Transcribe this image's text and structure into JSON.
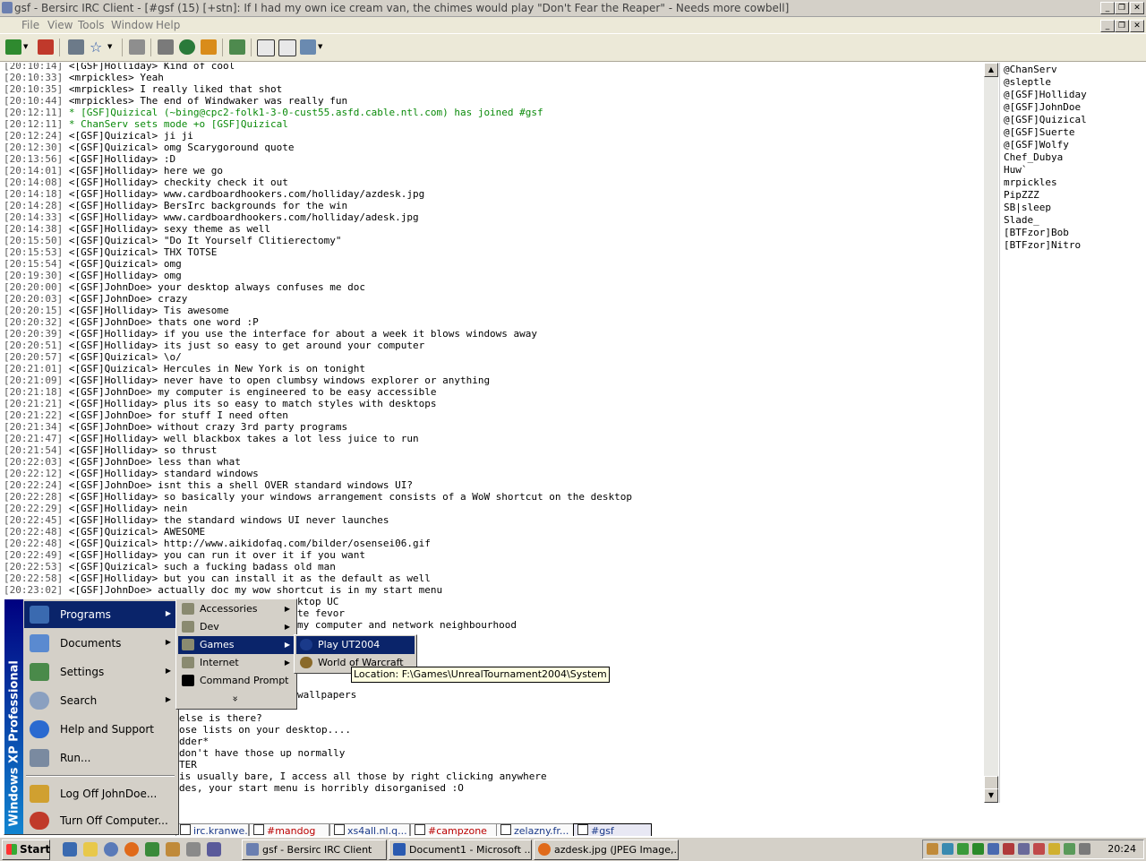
{
  "window": {
    "title": "gsf - Bersirc IRC Client - [#gsf (15) [+stn]: If I had my own ice cream van, the chimes would play \"Don't Fear the Reaper\" - Needs more cowbell]"
  },
  "menubar": [
    "File",
    "View",
    "Tools",
    "Window",
    "Help"
  ],
  "chat": {
    "lines": [
      {
        "ts": "[20:10:14]",
        "text": "<[GSF]Holliday> Kind of cool",
        "kind": "msg"
      },
      {
        "ts": "[20:10:33]",
        "text": "<mrpickles> Yeah",
        "kind": "msg"
      },
      {
        "ts": "[20:10:35]",
        "text": "<mrpickles> I really liked that shot",
        "kind": "msg"
      },
      {
        "ts": "[20:10:44]",
        "text": "<mrpickles> The end of Windwaker was really fun",
        "kind": "msg"
      },
      {
        "ts": "[20:12:11]",
        "text": "* [GSF]Quizical (~bing@cpc2-folk1-3-0-cust55.asfd.cable.ntl.com) has joined #gsf",
        "kind": "sys"
      },
      {
        "ts": "[20:12:11]",
        "text": "* ChanServ sets mode +o [GSF]Quizical",
        "kind": "sys"
      },
      {
        "ts": "[20:12:24]",
        "text": "<[GSF]Quizical> ji ji",
        "kind": "msg"
      },
      {
        "ts": "[20:12:30]",
        "text": "<[GSF]Quizical> omg Scarygoround quote",
        "kind": "msg"
      },
      {
        "ts": "[20:13:56]",
        "text": "<[GSF]Holliday> :D",
        "kind": "msg"
      },
      {
        "ts": "[20:14:01]",
        "text": "<[GSF]Holliday> here we go",
        "kind": "msg"
      },
      {
        "ts": "[20:14:08]",
        "text": "<[GSF]Holliday> checkity check it out",
        "kind": "msg"
      },
      {
        "ts": "[20:14:18]",
        "text": "<[GSF]Holliday> www.cardboardhookers.com/holliday/azdesk.jpg",
        "kind": "msg"
      },
      {
        "ts": "[20:14:28]",
        "text": "<[GSF]Holliday> BersIrc backgrounds for the win",
        "kind": "msg"
      },
      {
        "ts": "[20:14:33]",
        "text": "<[GSF]Holliday> www.cardboardhookers.com/holliday/adesk.jpg",
        "kind": "msg"
      },
      {
        "ts": "[20:14:38]",
        "text": "<[GSF]Holliday> sexy theme as well",
        "kind": "msg"
      },
      {
        "ts": "[20:15:50]",
        "text": "<[GSF]Quizical> \"Do It Yourself Clitierectomy\"",
        "kind": "msg"
      },
      {
        "ts": "[20:15:53]",
        "text": "<[GSF]Quizical> THX TOTSE",
        "kind": "msg"
      },
      {
        "ts": "[20:15:54]",
        "text": "<[GSF]Quizical> omg",
        "kind": "msg"
      },
      {
        "ts": "[20:19:30]",
        "text": "<[GSF]Holliday> omg",
        "kind": "msg"
      },
      {
        "ts": "[20:20:00]",
        "text": "<[GSF]JohnDoe> your desktop always confuses me doc",
        "kind": "msg"
      },
      {
        "ts": "[20:20:03]",
        "text": "<[GSF]JohnDoe> crazy",
        "kind": "msg"
      },
      {
        "ts": "[20:20:15]",
        "text": "<[GSF]Holliday> Tis awesome",
        "kind": "msg"
      },
      {
        "ts": "[20:20:32]",
        "text": "<[GSF]JohnDoe> thats one word :P",
        "kind": "msg"
      },
      {
        "ts": "[20:20:39]",
        "text": "<[GSF]Holliday> if you use the interface for about a week it blows windows away",
        "kind": "msg"
      },
      {
        "ts": "[20:20:51]",
        "text": "<[GSF]Holliday> its just so easy to get around your computer",
        "kind": "msg"
      },
      {
        "ts": "[20:20:57]",
        "text": "<[GSF]Quizical> \\o/",
        "kind": "msg"
      },
      {
        "ts": "[20:21:01]",
        "text": "<[GSF]Quizical> Hercules in New York is on tonight",
        "kind": "msg"
      },
      {
        "ts": "[20:21:09]",
        "text": "<[GSF]Holliday> never have to open clumbsy windows explorer or anything",
        "kind": "msg"
      },
      {
        "ts": "[20:21:18]",
        "text": "<[GSF]JohnDoe> my computer is engineered to be easy accessible",
        "kind": "msg"
      },
      {
        "ts": "[20:21:21]",
        "text": "<[GSF]Holliday> plus its so easy to match styles with desktops",
        "kind": "msg"
      },
      {
        "ts": "[20:21:22]",
        "text": "<[GSF]JohnDoe> for stuff I need often",
        "kind": "msg"
      },
      {
        "ts": "[20:21:34]",
        "text": "<[GSF]JohnDoe> without crazy 3rd party programs",
        "kind": "msg"
      },
      {
        "ts": "[20:21:47]",
        "text": "<[GSF]Holliday> well blackbox takes a lot less juice to run",
        "kind": "msg"
      },
      {
        "ts": "[20:21:54]",
        "text": "<[GSF]Holliday> so thrust",
        "kind": "msg"
      },
      {
        "ts": "[20:22:03]",
        "text": "<[GSF]JohnDoe> less than what",
        "kind": "msg"
      },
      {
        "ts": "[20:22:12]",
        "text": "<[GSF]Holliday> standard windows",
        "kind": "msg"
      },
      {
        "ts": "[20:22:24]",
        "text": "<[GSF]JohnDoe> isnt this a shell OVER standard windows UI?",
        "kind": "msg"
      },
      {
        "ts": "[20:22:28]",
        "text": "<[GSF]Holliday> so basically your windows arrangement consists of a WoW shortcut on the desktop",
        "kind": "msg"
      },
      {
        "ts": "[20:22:29]",
        "text": "<[GSF]Holliday> nein",
        "kind": "msg"
      },
      {
        "ts": "[20:22:45]",
        "text": "<[GSF]Holliday> the standard windows UI never launches",
        "kind": "msg"
      },
      {
        "ts": "[20:22:48]",
        "text": "<[GSF]Quizical> AWESOME",
        "kind": "msg"
      },
      {
        "ts": "[20:22:48]",
        "text": "<[GSF]Quizical> http://www.aikidofaq.com/bilder/osensei06.gif",
        "kind": "msg"
      },
      {
        "ts": "[20:22:49]",
        "text": "<[GSF]Holliday> you can run it over it if you want",
        "kind": "msg"
      },
      {
        "ts": "[20:22:53]",
        "text": "<[GSF]Quizical> such a fucking badass old man",
        "kind": "msg"
      },
      {
        "ts": "[20:22:58]",
        "text": "<[GSF]Holliday> but you can install it as the default as well",
        "kind": "msg"
      },
      {
        "ts": "[20:23:02]",
        "text": "<[GSF]JohnDoe> actually doc my wow shortcut is in my start menu",
        "kind": "msg"
      }
    ],
    "partial_lines": [
      {
        "text": "ktop UC",
        "row": 0
      },
      {
        "text": "te fevor",
        "row": 1
      },
      {
        "text": "my computer and network neighbourhood",
        "row": 2
      },
      {
        "text": "wallpapers",
        "row": 8
      },
      {
        "text": "else is there?",
        "row": 10
      },
      {
        "text": "ose lists on your desktop....",
        "row": 11
      },
      {
        "text": "dder*",
        "row": 12
      },
      {
        "text": "don't have those up normally",
        "row": 13
      },
      {
        "text": "TER",
        "row": 14
      },
      {
        "text": "is usually bare, I access all those by right clicking anywhere",
        "row": 15
      },
      {
        "text": "des, your start menu is horribly disorganised :O",
        "row": 16
      }
    ]
  },
  "nicklist": [
    "@ChanServ",
    "@sleptle",
    "@[GSF]Holliday",
    "@[GSF]JohnDoe",
    "@[GSF]Quizical",
    "@[GSF]Suerte",
    "@[GSF]Wolfy",
    "Chef_Dubya",
    "Huw`",
    "mrpickles",
    "PipZZZ",
    "SB|sleep",
    "Slade_",
    "[BTFzor]Bob",
    "[BTFzor]Nitro"
  ],
  "window_tabs": [
    "irc.kranwe...",
    "#mandog",
    "xs4all.nl.q...",
    "#campzone",
    "zelazny.fr...",
    "#gsf"
  ],
  "startmenu": {
    "sidebar_text": "Windows XP Professional",
    "items": [
      {
        "label": "Programs",
        "icon": "programs-icon",
        "submenu": true
      },
      {
        "label": "Documents",
        "icon": "documents-icon",
        "submenu": true
      },
      {
        "label": "Settings",
        "icon": "settings-icon",
        "submenu": true
      },
      {
        "label": "Search",
        "icon": "search-icon",
        "submenu": true
      },
      {
        "label": "Help and Support",
        "icon": "help-icon",
        "submenu": false
      },
      {
        "label": "Run...",
        "icon": "run-icon",
        "submenu": false
      },
      {
        "label": "Log Off JohnDoe...",
        "icon": "logoff-icon",
        "submenu": false
      },
      {
        "label": "Turn Off Computer...",
        "icon": "power-icon",
        "submenu": false
      }
    ]
  },
  "programs_menu": [
    "Accessories",
    "Dev",
    "Games",
    "Internet",
    "Command Prompt"
  ],
  "programs_more": "»",
  "games_menu": [
    "Play UT2004",
    "World of Warcraft"
  ],
  "tooltip": "Location: F:\\Games\\UnrealTournament2004\\System",
  "taskbar": {
    "start_label": "Start",
    "tasks": [
      "gsf - Bersirc IRC Client",
      "Document1 - Microsoft ...",
      "azdesk.jpg (JPEG Image,..."
    ],
    "clock": "20:24"
  },
  "colors": {
    "selection": "#0a246a",
    "system_message": "#0a8a0a",
    "chrome": "#d4d0c8"
  }
}
